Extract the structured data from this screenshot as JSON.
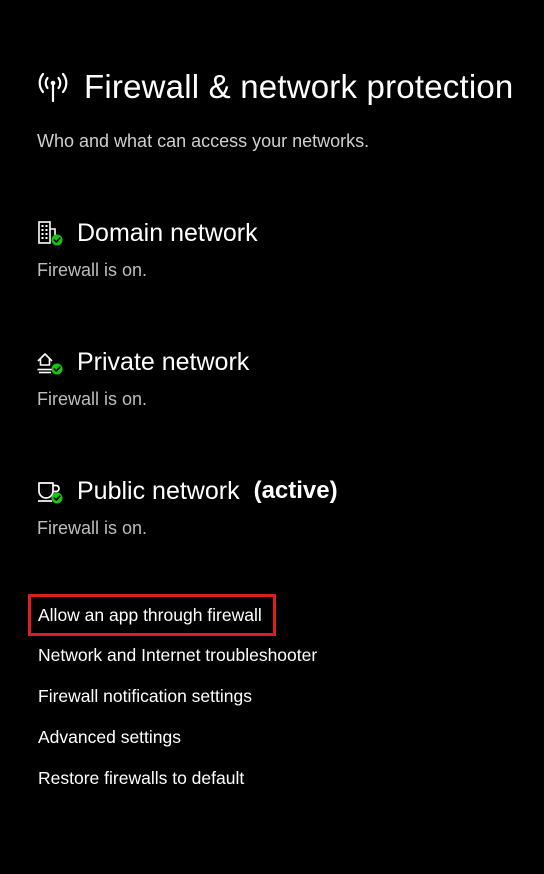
{
  "header": {
    "title": "Firewall & network protection",
    "subtitle": "Who and what can access your networks.",
    "icon": "wireless-antenna-icon"
  },
  "networks": [
    {
      "name": "Domain network",
      "active_label": "",
      "status": "Firewall is on.",
      "icon": "domain-building-icon"
    },
    {
      "name": "Private network",
      "active_label": "",
      "status": "Firewall is on.",
      "icon": "private-home-network-icon"
    },
    {
      "name": "Public network",
      "active_label": "(active)",
      "status": "Firewall is on.",
      "icon": "public-cafe-network-icon"
    }
  ],
  "links": [
    {
      "label": "Allow an app through firewall",
      "highlighted": true
    },
    {
      "label": "Network and Internet troubleshooter"
    },
    {
      "label": "Firewall notification settings"
    },
    {
      "label": "Advanced settings"
    },
    {
      "label": "Restore firewalls to default"
    }
  ],
  "colors": {
    "background": "#000000",
    "text": "#ffffff",
    "secondary_text": "#bdbdbd",
    "status_ok_green": "#16c60c",
    "highlight_red": "#e01b24"
  }
}
